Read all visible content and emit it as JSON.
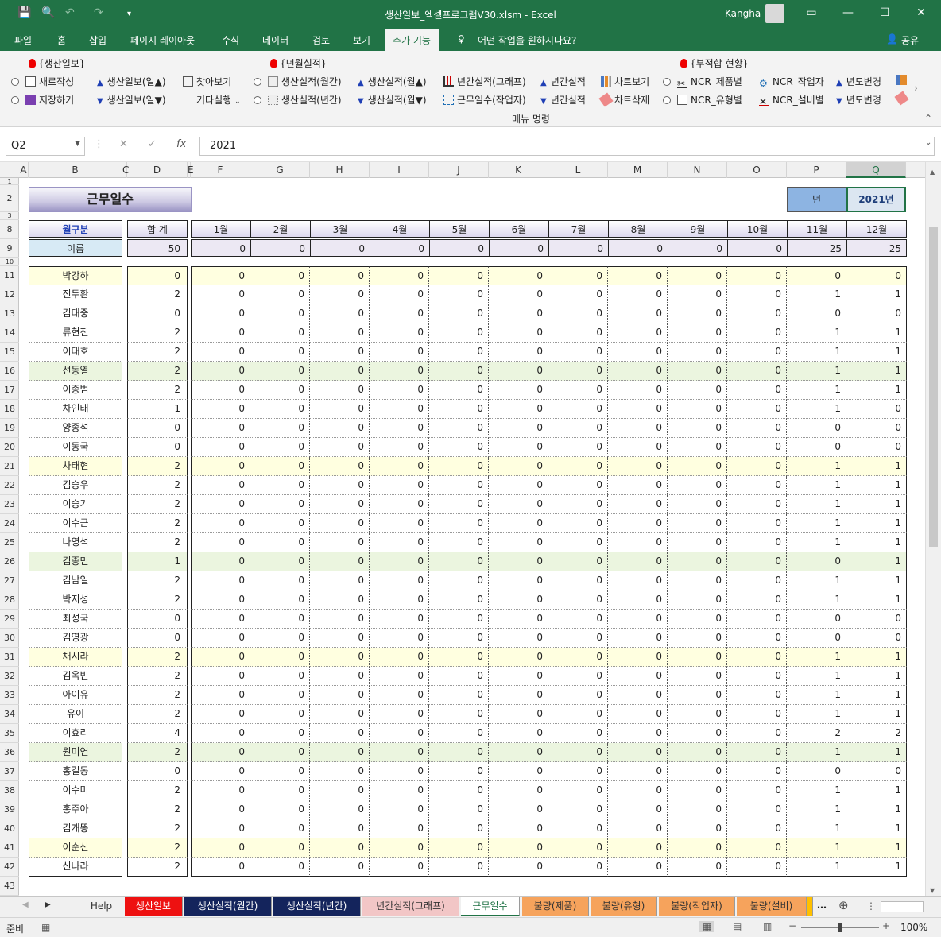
{
  "window": {
    "title": "생산일보_엑셀프로그램V30.xlsm  -  Excel",
    "user": "Kangha"
  },
  "ribbon_tabs": [
    "파일",
    "홈",
    "삽입",
    "페이지 레이아웃",
    "수식",
    "데이터",
    "검토",
    "보기",
    "추가 기능",
    "어떤 작업을 원하시나요?",
    "공유"
  ],
  "ribbon": {
    "group1_title": "{생산일보}",
    "group2_title": "{년월실적}",
    "group3_title": "{부적합 현황}",
    "footer": "메뉴 명령",
    "items": {
      "new": "새로작성",
      "save": "저장하기",
      "daily_up": "생산일보(일▲)",
      "daily_down": "생산일보(일▼)",
      "find": "찾아보기",
      "other": "기타실행",
      "monthly": "생산실적(월간)",
      "yearly": "생산실적(년간)",
      "month_up": "생산실적(월▲)",
      "month_down": "생산실적(월▼)",
      "annual_graph": "년간실적(그래프)",
      "workdays": "근무일수(작업자)",
      "annual1": "년간실적",
      "annual2": "년간실적",
      "chart_view": "차트보기",
      "chart_del": "차트삭제",
      "ncr_product": "NCR_제품별",
      "ncr_type": "NCR_유형별",
      "ncr_worker": "NCR_작업자",
      "ncr_equip": "NCR_설비별",
      "year_change1": "년도변경",
      "year_change2": "년도변경"
    }
  },
  "formula_bar": {
    "name_box": "Q2",
    "formula": "2021",
    "fx": "fx"
  },
  "columns": [
    "A",
    "B",
    "C",
    "D",
    "E",
    "F",
    "G",
    "H",
    "I",
    "J",
    "K",
    "L",
    "M",
    "N",
    "O",
    "P",
    "Q"
  ],
  "sheet": {
    "title": "근무일수",
    "year_label": "년",
    "year_value": "2021년",
    "header_month": "월구분",
    "header_total": "합  계",
    "header_name": "이름",
    "total_all": "50",
    "months": [
      "1월",
      "2월",
      "3월",
      "4월",
      "5월",
      "6월",
      "7월",
      "8월",
      "9월",
      "10월",
      "11월",
      "12월"
    ],
    "month_totals": [
      "0",
      "0",
      "0",
      "0",
      "0",
      "0",
      "0",
      "0",
      "0",
      "0",
      "25",
      "25"
    ],
    "rows": [
      {
        "r": "11",
        "name": "박강하",
        "total": "0",
        "nov": "0",
        "dec": "0"
      },
      {
        "r": "12",
        "name": "전두환",
        "total": "2",
        "nov": "1",
        "dec": "1"
      },
      {
        "r": "13",
        "name": "김대중",
        "total": "0",
        "nov": "0",
        "dec": "0"
      },
      {
        "r": "14",
        "name": "류현진",
        "total": "2",
        "nov": "1",
        "dec": "1"
      },
      {
        "r": "15",
        "name": "이대호",
        "total": "2",
        "nov": "1",
        "dec": "1"
      },
      {
        "r": "16",
        "name": "선동열",
        "total": "2",
        "nov": "1",
        "dec": "1"
      },
      {
        "r": "17",
        "name": "이종범",
        "total": "2",
        "nov": "1",
        "dec": "1"
      },
      {
        "r": "18",
        "name": "차인태",
        "total": "1",
        "nov": "1",
        "dec": "0"
      },
      {
        "r": "19",
        "name": "양종석",
        "total": "0",
        "nov": "0",
        "dec": "0"
      },
      {
        "r": "20",
        "name": "이동국",
        "total": "0",
        "nov": "0",
        "dec": "0"
      },
      {
        "r": "21",
        "name": "차태현",
        "total": "2",
        "nov": "1",
        "dec": "1"
      },
      {
        "r": "22",
        "name": "김승우",
        "total": "2",
        "nov": "1",
        "dec": "1"
      },
      {
        "r": "23",
        "name": "이승기",
        "total": "2",
        "nov": "1",
        "dec": "1"
      },
      {
        "r": "24",
        "name": "이수근",
        "total": "2",
        "nov": "1",
        "dec": "1"
      },
      {
        "r": "25",
        "name": "나영석",
        "total": "2",
        "nov": "1",
        "dec": "1"
      },
      {
        "r": "26",
        "name": "김종민",
        "total": "1",
        "nov": "0",
        "dec": "1"
      },
      {
        "r": "27",
        "name": "김남일",
        "total": "2",
        "nov": "1",
        "dec": "1"
      },
      {
        "r": "28",
        "name": "박지성",
        "total": "2",
        "nov": "1",
        "dec": "1"
      },
      {
        "r": "29",
        "name": "최성국",
        "total": "0",
        "nov": "0",
        "dec": "0"
      },
      {
        "r": "30",
        "name": "김영광",
        "total": "0",
        "nov": "0",
        "dec": "0"
      },
      {
        "r": "31",
        "name": "채시라",
        "total": "2",
        "nov": "1",
        "dec": "1"
      },
      {
        "r": "32",
        "name": "김옥빈",
        "total": "2",
        "nov": "1",
        "dec": "1"
      },
      {
        "r": "33",
        "name": "아이유",
        "total": "2",
        "nov": "1",
        "dec": "1"
      },
      {
        "r": "34",
        "name": "유이",
        "total": "2",
        "nov": "1",
        "dec": "1"
      },
      {
        "r": "35",
        "name": "이효리",
        "total": "4",
        "nov": "2",
        "dec": "2"
      },
      {
        "r": "36",
        "name": "원미연",
        "total": "2",
        "nov": "1",
        "dec": "1"
      },
      {
        "r": "37",
        "name": "홍길동",
        "total": "0",
        "nov": "0",
        "dec": "0"
      },
      {
        "r": "38",
        "name": "이수미",
        "total": "2",
        "nov": "1",
        "dec": "1"
      },
      {
        "r": "39",
        "name": "홍주아",
        "total": "2",
        "nov": "1",
        "dec": "1"
      },
      {
        "r": "40",
        "name": "김개똥",
        "total": "2",
        "nov": "1",
        "dec": "1"
      },
      {
        "r": "41",
        "name": "이순신",
        "total": "2",
        "nov": "1",
        "dec": "1"
      },
      {
        "r": "42",
        "name": "신나라",
        "total": "2",
        "nov": "1",
        "dec": "1"
      }
    ],
    "zero": "0"
  },
  "sheet_tabs": [
    {
      "label": "Help",
      "bg": "#f0f0f0",
      "fg": "#333333"
    },
    {
      "label": "생산일보",
      "bg": "#ee1111",
      "fg": "#ffffff"
    },
    {
      "label": "생산실적(월간)",
      "bg": "#14245c",
      "fg": "#ffffff"
    },
    {
      "label": "생산실적(년간)",
      "bg": "#14245c",
      "fg": "#ffffff"
    },
    {
      "label": "년간실적(그래프)",
      "bg": "#f2c6c6",
      "fg": "#333333"
    },
    {
      "label": "근무일수",
      "bg": "#ffffff",
      "fg": "#217346"
    },
    {
      "label": "불량(제품)",
      "bg": "#f6a35c",
      "fg": "#333333"
    },
    {
      "label": "불량(유형)",
      "bg": "#f6a35c",
      "fg": "#333333"
    },
    {
      "label": "불량(작업자)",
      "bg": "#f6a35c",
      "fg": "#333333"
    },
    {
      "label": "불량(설비)",
      "bg": "#f6a35c",
      "fg": "#333333"
    }
  ],
  "status": {
    "ready": "준비",
    "zoom": "100%"
  },
  "colors": {
    "excel_green": "#217346",
    "title_purple": "#9a94c4",
    "year_blue": "#8db4e2",
    "row_yellow": "#ffffe0",
    "row_green": "#ebf5df"
  }
}
